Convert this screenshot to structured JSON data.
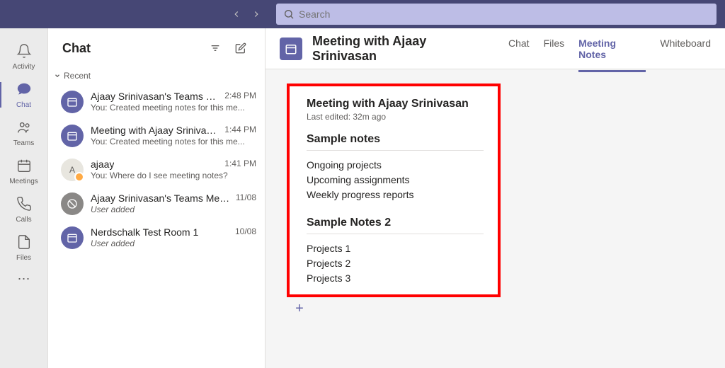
{
  "search": {
    "placeholder": "Search"
  },
  "rail": {
    "activity": "Activity",
    "chat": "Chat",
    "teams": "Teams",
    "meetings": "Meetings",
    "calls": "Calls",
    "files": "Files"
  },
  "chat": {
    "header": "Chat",
    "section": "Recent",
    "items": [
      {
        "title": "Ajaay Srinivasan's Teams Mee...",
        "time": "2:48 PM",
        "preview": "You: Created meeting notes for this me...",
        "avatar": "purple",
        "italic": false
      },
      {
        "title": "Meeting with Ajaay Srinivasan",
        "time": "1:44 PM",
        "preview": "You: Created meeting notes for this me...",
        "avatar": "purple",
        "italic": false
      },
      {
        "title": "ajaay",
        "time": "1:41 PM",
        "preview": "You: Where do I see meeting notes?",
        "avatar": "user",
        "italic": false
      },
      {
        "title": "Ajaay Srinivasan's Teams Meeting",
        "time": "11/08",
        "preview": "User added",
        "avatar": "gray",
        "italic": true
      },
      {
        "title": "Nerdschalk Test Room 1",
        "time": "10/08",
        "preview": "User added",
        "avatar": "purple",
        "italic": true
      }
    ]
  },
  "content": {
    "title": "Meeting with Ajaay Srinivasan",
    "tabs": {
      "chat": "Chat",
      "files": "Files",
      "notes": "Meeting Notes",
      "whiteboard": "Whiteboard"
    }
  },
  "notes": {
    "title": "Meeting with Ajaay Srinivasan",
    "meta": "Last edited: 32m ago",
    "section1": {
      "heading": "Sample notes",
      "lines": [
        "Ongoing projects",
        "Upcoming assignments",
        "Weekly progress reports"
      ]
    },
    "section2": {
      "heading": "Sample Notes 2",
      "lines": [
        "Projects 1",
        "Projects 2",
        "Projects 3"
      ]
    }
  }
}
